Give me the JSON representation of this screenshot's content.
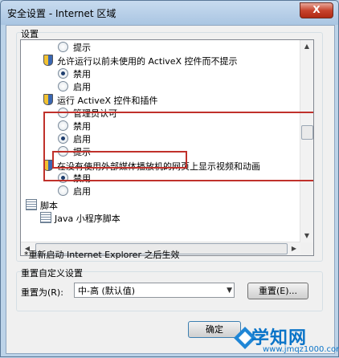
{
  "window": {
    "title": "安全设置 - Internet 区域",
    "close_label": "X"
  },
  "settings_group": {
    "label": "设置"
  },
  "list": [
    {
      "kind": "radio",
      "checked": false,
      "label": "提示"
    },
    {
      "kind": "header",
      "icon": "shield-icon",
      "label": "允许运行以前未使用的 ActiveX 控件而不提示"
    },
    {
      "kind": "radio",
      "checked": true,
      "label": "禁用"
    },
    {
      "kind": "radio",
      "checked": false,
      "label": "启用"
    },
    {
      "kind": "header",
      "icon": "shield-icon",
      "label": "运行 ActiveX 控件和插件"
    },
    {
      "kind": "radio",
      "checked": false,
      "label": "管理员认可"
    },
    {
      "kind": "radio",
      "checked": false,
      "label": "禁用"
    },
    {
      "kind": "radio",
      "checked": true,
      "label": "启用"
    },
    {
      "kind": "radio",
      "checked": false,
      "label": "提示"
    },
    {
      "kind": "header",
      "icon": "shield-icon",
      "label": "在没有使用外部媒体播放机的网页上显示视频和动画"
    },
    {
      "kind": "radio",
      "checked": true,
      "label": "禁用"
    },
    {
      "kind": "radio",
      "checked": false,
      "label": "启用"
    },
    {
      "kind": "header",
      "icon": "script-icon",
      "label": "脚本"
    },
    {
      "kind": "header",
      "icon": "script-icon",
      "label": "Java 小程序脚本"
    }
  ],
  "note": "*重新启动 Internet Explorer 之后生效",
  "reset_group": {
    "label": "重置自定义设置",
    "reset_to_label": "重置为(R):",
    "selected": "中-高 (默认值)",
    "reset_button": "重置(E)..."
  },
  "ok_button": "确定",
  "watermark": {
    "title": "学知网",
    "url": "www.jmqz1000.com"
  }
}
